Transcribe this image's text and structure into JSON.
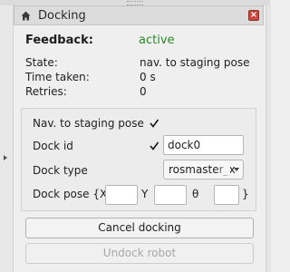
{
  "panel": {
    "title": "Docking"
  },
  "feedback": {
    "label": "Feedback:",
    "value": "active"
  },
  "state": {
    "label": "State:",
    "value": "nav. to staging pose"
  },
  "time_taken": {
    "label": "Time taken:",
    "value": "0 s"
  },
  "retries": {
    "label": "Retries:",
    "value": "0"
  },
  "form": {
    "nav_to_staging_pose": {
      "label": "Nav. to staging pose",
      "checked": true
    },
    "dock_id": {
      "label": "Dock id",
      "checked": true,
      "value": "dock0"
    },
    "dock_type": {
      "label": "Dock type",
      "selected": "rosmaster_x"
    },
    "dock_pose": {
      "label": "Dock pose {X",
      "y_label": "Y",
      "theta_label": "θ",
      "close": "}",
      "x": "",
      "y": "",
      "theta": ""
    }
  },
  "buttons": {
    "cancel": "Cancel docking",
    "undock": "Undock robot"
  },
  "colors": {
    "active": "#2a8a2a",
    "close_button": "#c8463d"
  }
}
